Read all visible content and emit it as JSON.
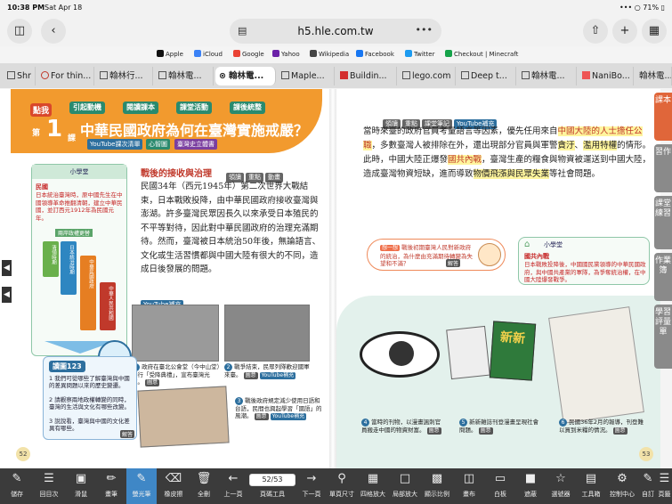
{
  "status": {
    "time": "10:38 PM",
    "date": "Sat Apr 18",
    "battery": "71%"
  },
  "browser": {
    "url": "h5.hle.com.tw",
    "dots": "•••"
  },
  "bookmarks": [
    {
      "label": "Apple",
      "color": "#111111"
    },
    {
      "label": "iCloud",
      "color": "#3b82f6"
    },
    {
      "label": "Google",
      "color": "#ea4335"
    },
    {
      "label": "Yahoo",
      "color": "#6b21a8"
    },
    {
      "label": "Wikipedia",
      "color": "#444444"
    },
    {
      "label": "Facebook",
      "color": "#1877f2"
    },
    {
      "label": "Twitter",
      "color": "#1d9bf0"
    },
    {
      "label": "Checkout | Minecraft",
      "color": "#16a34a"
    }
  ],
  "tabs": [
    "Shr",
    "For thin...",
    "翰林行...",
    "翰林電...",
    "翰林電...",
    "Maple...",
    "Buildin...",
    "lego.com",
    "Deep t...",
    "翰林電...",
    "NaniBo...",
    "翰林電..."
  ],
  "lesson": {
    "badge_label": "點我",
    "number": "1",
    "course_label": "課",
    "nav_pills": [
      "引起動機",
      "閱讀課本",
      "課堂活動",
      "課後統整"
    ],
    "title": "中華民國政府為何在臺灣實施戒嚴？",
    "sub_tags": [
      "YouTube課次清單",
      "心智圖",
      "臺灣史立體書"
    ]
  },
  "sidebox": {
    "head": "小學堂",
    "sub": "民國",
    "text": "日本統治臺灣時，原中國先生在中國領導革命推翻清朝，建立中華民國，並訂西元1912年為民國元年。",
    "timeline_label": "兩岸政權更替",
    "bars": [
      "清領時期",
      "日本統治時期",
      "中華民國政府",
      "中華人民共和國"
    ],
    "years": [
      "民國元年",
      "民國34年",
      "民國38年"
    ]
  },
  "section": {
    "heading": "戰後的接收與治理",
    "tags": [
      "領讀",
      "重點",
      "動畫"
    ],
    "body": "民國34年（西元1945年）第二次世界大戰結束，日本戰敗投降，由中華民國政府接收臺灣與澎湖。許多臺灣民眾因長久以來承受日本殖民的不平等對待，因此對中華民國政府的治理充滿期待。然而，臺灣被日本統治50年後，無論語言、文化或生活習慣都與中國大陸有很大的不同，造成日後發展的問題。",
    "yt_tag": "YouTube補充"
  },
  "photos": [
    {
      "num": "1",
      "text": "政府在臺北公會堂（今中山堂）舉行「受降典禮」，宣布臺灣光復。",
      "tag": "圖意"
    },
    {
      "num": "2",
      "text": "戰爭結束，民眾列隊歡迎國軍來臺。",
      "tag": "圖意",
      "tag2": "YouTube補充"
    },
    {
      "num": "3",
      "text": "戰後政府規定減少使用日語和台語，民間也興起學習「國語」的風潮。",
      "tag": "圖意",
      "tag2": "YouTube補充"
    }
  ],
  "study": {
    "head": "讀圖123",
    "items": [
      "1 我們可從哪些了解臺灣與中國的差異問題以來的歷史變遷。",
      "2 請觀察兩地政權轉變的同時，臺灣的生活與文化有哪些改變。",
      "3 說說看，臺灣與中國的文化差異有哪些。"
    ],
    "answer": "解答"
  },
  "pagenums": {
    "left": "52",
    "right": "53"
  },
  "right": {
    "tags": [
      "領讀",
      "重點",
      "課堂筆記"
    ],
    "yt_tag": "YouTube補充",
    "body_start": "當時來臺的政府官員考量語言等因素，優先任用來自",
    "body_hl1": "中國大陸的人士擔任公職",
    "body_mid1": "，多數臺灣人被排除在外，還出現部分官員與軍警",
    "body_hl2": "貪汙",
    "body_mid2": "、",
    "body_hl3": "濫用特權",
    "body_mid3": "的情形。此時，中國大陸正爆發",
    "body_hl4": "國共內戰",
    "body_mid4": "，臺灣生產的糧食與物資被運送到中國大陸，造成臺灣物資短缺，進而導致",
    "body_hl5": "物價飛漲與民眾失業",
    "body_end": "等社會問題。",
    "question_tag": "想一想",
    "question": "戰後初期臺灣人民對新政府的統治，為什麼由充滿期待轉變為失望和不滿？",
    "question_answer": "解答",
    "note_head": "小學堂",
    "note_sub": "國共內戰",
    "note_text": "日本戰敗投降後，中國國民黨領導的中華民國政府，與中國共產黨的軍隊，為爭奪統治權，在中國大陸爆發戰爭。",
    "captions": [
      {
        "num": "4",
        "text": "當時的刊物，以漫畫諷刺官員搬走中國的物資財富。",
        "tag": "圖意"
      },
      {
        "num": "5",
        "text": "新新雜誌刊登漫畫呈現社會問題。",
        "tag": "圖意"
      },
      {
        "num": "6",
        "text": "民國36年2月的報導，刊登難以買到米糧的情況。",
        "tag": "圖意"
      }
    ],
    "magazine_title": "新新"
  },
  "side_tabs": [
    {
      "label": "課本",
      "color": "#e0663a"
    },
    {
      "label": "習作",
      "color": "#8a8a8a"
    },
    {
      "label": "課堂練習",
      "color": "#8a8a8a"
    },
    {
      "label": "作業簿",
      "color": "#8a8a8a"
    },
    {
      "label": "學習評量單",
      "color": "#8a8a8a"
    }
  ],
  "toolbar": {
    "tools": [
      "儲存",
      "回目次",
      "滑鼠",
      "畫筆",
      "螢光筆",
      "橡皮擦",
      "全刪",
      "上一頁",
      "頁碼工具",
      "下一頁",
      "單頁尺寸",
      "四格放大",
      "局部放大",
      "顯示比例",
      "畫布",
      "白板",
      "遮蔽",
      "選號器",
      "工具箱",
      "控制中心",
      "自訂",
      "頁籤"
    ],
    "active_tool": "螢光筆",
    "page_value": "52/53",
    "zoom_label": "遮蔽"
  },
  "colors": {
    "accent_orange": "#f29a2e",
    "toolbar": "#3b3b3b",
    "highlight": "#fff59d",
    "active_tool": "#3f87c6"
  }
}
